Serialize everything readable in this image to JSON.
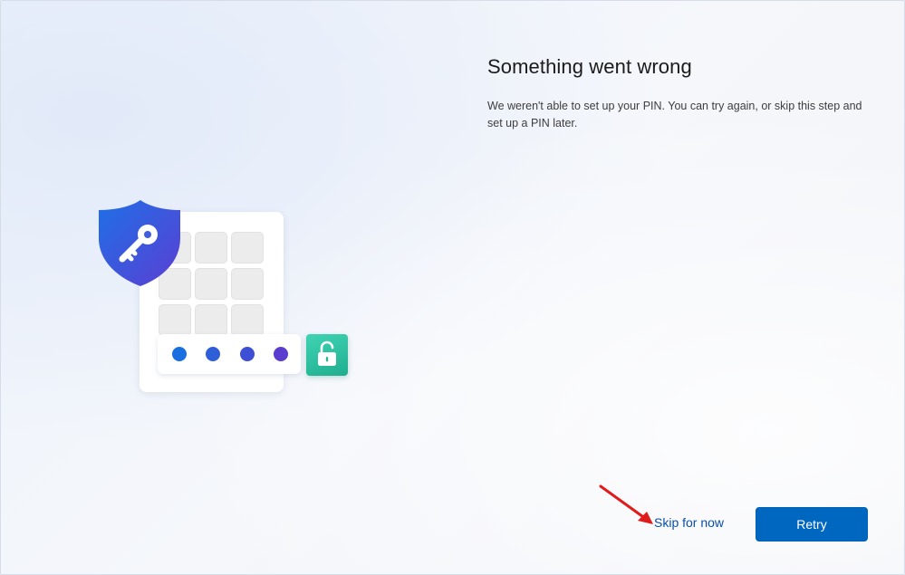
{
  "dialog": {
    "title": "Something went wrong",
    "message": "We weren't able to set up your PIN. You can try again, or skip this step and set up a PIN later."
  },
  "actions": {
    "skip_label": "Skip for now",
    "retry_label": "Retry"
  },
  "illustration": {
    "icons": [
      "shield-key-icon",
      "keypad",
      "pin-dots",
      "unlock-icon"
    ],
    "pin_dot_colors": [
      "#1a6fe0",
      "#2f5fd8",
      "#3d4fd4",
      "#5a3ccf"
    ],
    "shield_colors": [
      "#1f6fe6",
      "#5b3fd3"
    ],
    "unlock_tile_color": "#2ec4a2"
  },
  "colors": {
    "accent": "#0067c0",
    "link": "#0a4ea6",
    "annotation_arrow": "#e01b1b"
  }
}
